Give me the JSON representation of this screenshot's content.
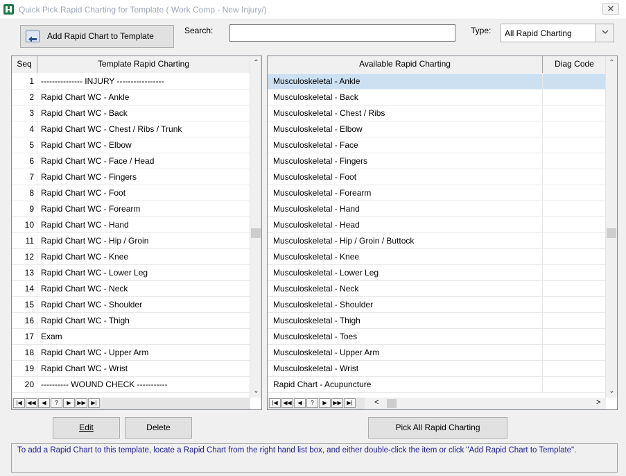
{
  "window": {
    "title": "Quick Pick Rapid Charting for Template ( Work Comp - New Injury/)",
    "close_glyph": "✕",
    "app_icon": "app-logo-icon"
  },
  "toolbar": {
    "add_button": "Add Rapid Chart to Template",
    "add_icon": "arrow-left-icon",
    "search_label": "Search:",
    "search_value": "",
    "type_label": "Type:",
    "type_value": "All Rapid Charting"
  },
  "left_grid": {
    "columns": [
      "Seq",
      "Template Rapid Charting"
    ],
    "rows": [
      [
        "1",
        "--------------- INJURY -----------------"
      ],
      [
        "2",
        "Rapid Chart WC - Ankle"
      ],
      [
        "3",
        "Rapid Chart WC - Back"
      ],
      [
        "4",
        "Rapid Chart WC - Chest / Ribs / Trunk"
      ],
      [
        "5",
        "Rapid Chart WC - Elbow"
      ],
      [
        "6",
        "Rapid Chart WC - Face / Head"
      ],
      [
        "7",
        "Rapid Chart WC - Fingers"
      ],
      [
        "8",
        "Rapid Chart WC - Foot"
      ],
      [
        "9",
        "Rapid Chart WC - Forearm"
      ],
      [
        "10",
        "Rapid Chart WC - Hand"
      ],
      [
        "11",
        "Rapid Chart WC - Hip / Groin"
      ],
      [
        "12",
        "Rapid Chart WC - Knee"
      ],
      [
        "13",
        "Rapid Chart WC - Lower Leg"
      ],
      [
        "14",
        "Rapid Chart WC - Neck"
      ],
      [
        "15",
        "Rapid Chart WC - Shoulder"
      ],
      [
        "16",
        "Rapid Chart WC - Thigh"
      ],
      [
        "17",
        "Exam"
      ],
      [
        "18",
        "Rapid Chart WC - Upper Arm"
      ],
      [
        "19",
        "Rapid Chart WC - Wrist"
      ],
      [
        "20",
        "---------- WOUND CHECK -----------"
      ]
    ]
  },
  "right_grid": {
    "columns": [
      "Available Rapid Charting",
      "Diag Code"
    ],
    "rows": [
      [
        "Musculoskeletal - Ankle",
        ""
      ],
      [
        "Musculoskeletal - Back",
        ""
      ],
      [
        "Musculoskeletal - Chest / Ribs",
        ""
      ],
      [
        "Musculoskeletal - Elbow",
        ""
      ],
      [
        "Musculoskeletal - Face",
        ""
      ],
      [
        "Musculoskeletal - Fingers",
        ""
      ],
      [
        "Musculoskeletal - Foot",
        ""
      ],
      [
        "Musculoskeletal - Forearm",
        ""
      ],
      [
        "Musculoskeletal - Hand",
        ""
      ],
      [
        "Musculoskeletal - Head",
        ""
      ],
      [
        "Musculoskeletal - Hip / Groin / Buttock",
        ""
      ],
      [
        "Musculoskeletal - Knee",
        ""
      ],
      [
        "Musculoskeletal - Lower Leg",
        ""
      ],
      [
        "Musculoskeletal - Neck",
        ""
      ],
      [
        "Musculoskeletal - Shoulder",
        ""
      ],
      [
        "Musculoskeletal - Thigh",
        ""
      ],
      [
        "Musculoskeletal - Toes",
        ""
      ],
      [
        "Musculoskeletal - Upper Arm",
        ""
      ],
      [
        "Musculoskeletal - Wrist",
        ""
      ],
      [
        "Rapid Chart - Acupuncture",
        ""
      ]
    ],
    "selected_index": 0
  },
  "navigator": [
    "|◀",
    "◀◀",
    "◀",
    "?",
    "▶",
    "▶▶",
    "▶|"
  ],
  "scroll_glyphs": {
    "up": "⌃",
    "down": "⌄",
    "left": "<",
    "right": ">"
  },
  "buttons": {
    "edit": "Edit",
    "delete": "Delete",
    "pick_all": "Pick All Rapid Charting"
  },
  "info_text": "To add a Rapid Chart to this template, locate a Rapid Chart from the right hand list box, and either double-click the item or click \"Add Rapid Chart to Template\".",
  "colors": {
    "selection": "#cce0f2",
    "info_text": "#1a1a99",
    "title_text": "#a0a8b8"
  }
}
